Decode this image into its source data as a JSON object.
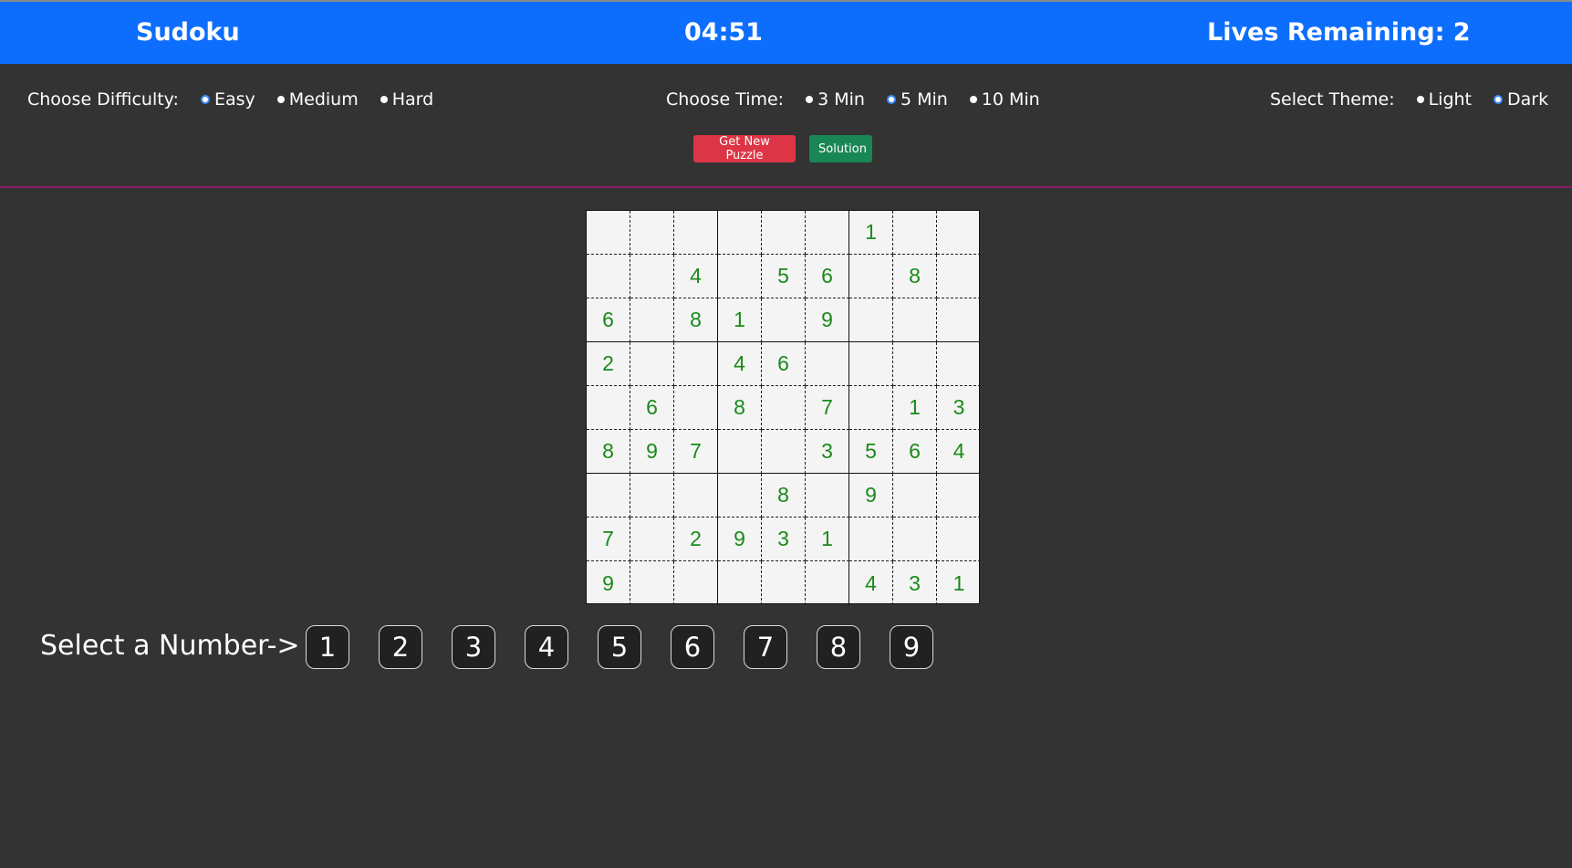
{
  "header": {
    "title": "Sudoku",
    "timer": "04:51",
    "lives": "Lives Remaining: 2"
  },
  "difficulty": {
    "label": "Choose Difficulty:",
    "options": [
      "Easy",
      "Medium",
      "Hard"
    ],
    "selected": "Easy"
  },
  "time": {
    "label": "Choose Time:",
    "options": [
      "3 Min",
      "5 Min",
      "10 Min"
    ],
    "selected": "5 Min"
  },
  "theme": {
    "label": "Select Theme:",
    "options": [
      "Light",
      "Dark"
    ],
    "selected": "Dark"
  },
  "buttons": {
    "new_puzzle": "Get New Puzzle",
    "solution": "Solution"
  },
  "board": [
    [
      "",
      "",
      "",
      "",
      "",
      "",
      "1",
      "",
      ""
    ],
    [
      "",
      "",
      "4",
      "",
      "5",
      "6",
      "",
      "8",
      ""
    ],
    [
      "6",
      "",
      "8",
      "1",
      "",
      "9",
      "",
      "",
      ""
    ],
    [
      "2",
      "",
      "",
      "4",
      "6",
      "",
      "",
      "",
      ""
    ],
    [
      "",
      "6",
      "",
      "8",
      "",
      "7",
      "",
      "1",
      "3"
    ],
    [
      "8",
      "9",
      "7",
      "",
      "",
      "3",
      "5",
      "6",
      "4"
    ],
    [
      "",
      "",
      "",
      "",
      "8",
      "",
      "9",
      "",
      ""
    ],
    [
      "7",
      "",
      "2",
      "9",
      "3",
      "1",
      "",
      "",
      ""
    ],
    [
      "9",
      "",
      "",
      "",
      "",
      "",
      "4",
      "3",
      "1"
    ]
  ],
  "number_select": {
    "label": "Select a Number->",
    "numbers": [
      "1",
      "2",
      "3",
      "4",
      "5",
      "6",
      "7",
      "8",
      "9"
    ]
  },
  "colors": {
    "header_bg": "#0d6efd",
    "page_bg": "#333333",
    "cell_text": "#1a8a1a",
    "divider": "#8b1a6b",
    "new_puzzle_bg": "#dc3545",
    "solution_bg": "#198754"
  }
}
